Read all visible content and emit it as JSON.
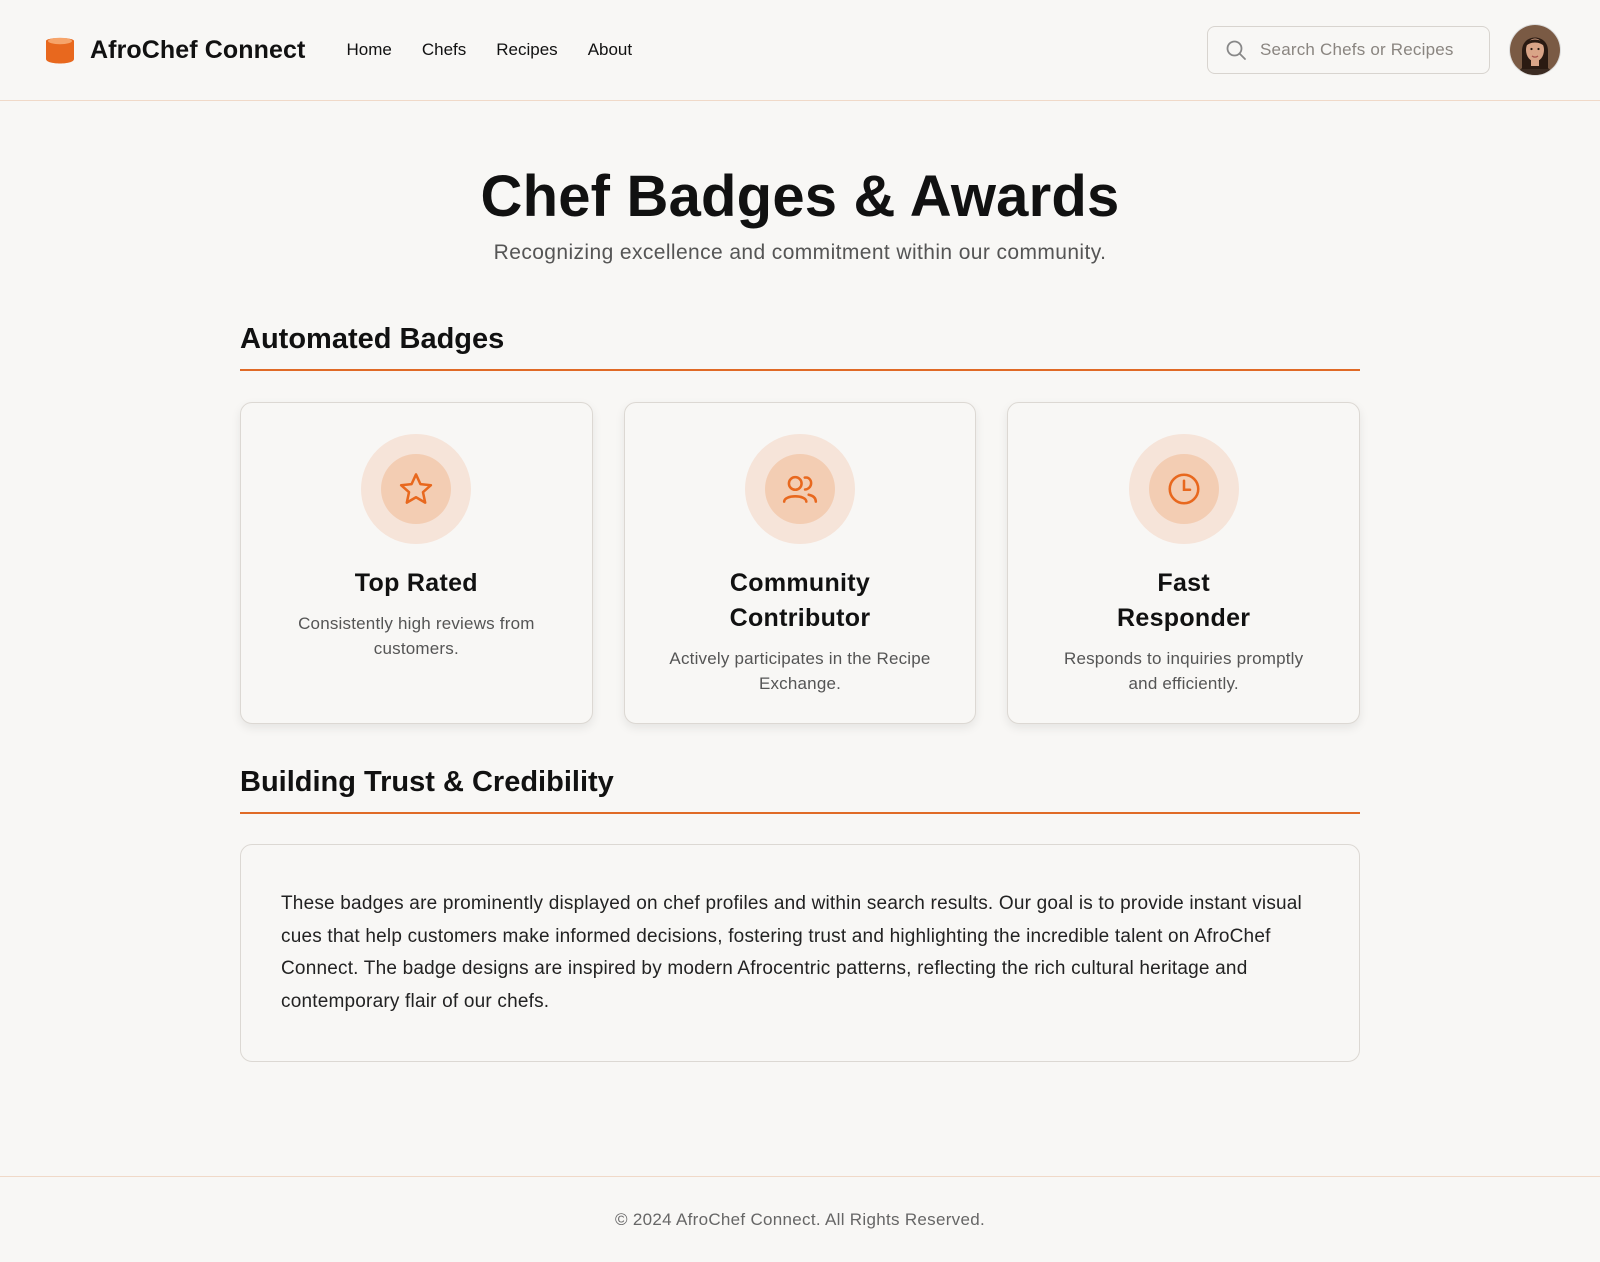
{
  "brand": {
    "name": "AfroChef Connect",
    "logo_icon": "cooking-pot-icon",
    "accent": "#e8681e"
  },
  "nav": {
    "items": [
      {
        "label": "Home"
      },
      {
        "label": "Chefs"
      },
      {
        "label": "Recipes"
      },
      {
        "label": "About"
      }
    ]
  },
  "search": {
    "placeholder": "Search Chefs or Recipes",
    "value": ""
  },
  "user": {
    "avatar": "user-avatar"
  },
  "page": {
    "title": "Chef Badges & Awards",
    "subtitle": "Recognizing excellence and commitment within our community."
  },
  "automated_badges": {
    "heading": "Automated Badges",
    "badges": [
      {
        "icon": "star-icon",
        "title": "Top Rated",
        "description": "Consistently high reviews from customers."
      },
      {
        "icon": "users-icon",
        "title": "Community Contributor",
        "description": "Actively participates in the Recipe Exchange."
      },
      {
        "icon": "clock-icon",
        "title": "Fast Responder",
        "description": "Responds to inquiries promptly and efficiently."
      }
    ]
  },
  "trust": {
    "heading": "Building Trust & Credibility",
    "body": "These badges are prominently displayed on chef profiles and within search results. Our goal is to provide instant visual cues that help customers make informed decisions, fostering trust and highlighting the incredible talent on AfroChef Connect. The badge designs are inspired by modern Afrocentric patterns, reflecting the rich cultural heritage and contemporary flair of our chefs."
  },
  "footer": {
    "copyright": "© 2024 AfroChef Connect. All Rights Reserved."
  }
}
